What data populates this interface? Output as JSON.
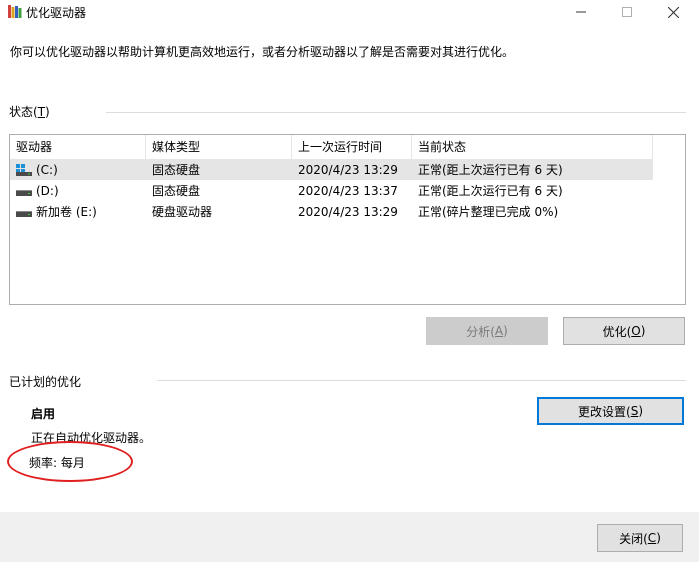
{
  "window": {
    "title": "优化驱动器",
    "minimize_icon": "minimize-icon",
    "maximize_icon": "maximize-icon",
    "close_icon": "close-icon"
  },
  "intro_text": "你可以优化驱动器以帮助计算机更高效地运行，或者分析驱动器以了解是否需要对其进行优化。",
  "status_section": {
    "label_main": "状态(",
    "label_key": "T",
    "label_end": ")"
  },
  "table": {
    "headers": [
      "驱动器",
      "媒体类型",
      "上一次运行时间",
      "当前状态"
    ],
    "rows": [
      {
        "drive": "(C:)",
        "icon": "system-drive-icon",
        "media": "固态硬盘",
        "last_run": "2020/4/23 13:29",
        "status": "正常(距上次运行已有 6 天)",
        "selected": true
      },
      {
        "drive": "(D:)",
        "icon": "drive-icon",
        "media": "固态硬盘",
        "last_run": "2020/4/23 13:37",
        "status": "正常(距上次运行已有 6 天)",
        "selected": false
      },
      {
        "drive": "新加卷 (E:)",
        "icon": "drive-icon",
        "media": "硬盘驱动器",
        "last_run": "2020/4/23 13:29",
        "status": "正常(碎片整理已完成 0%)",
        "selected": false
      }
    ]
  },
  "buttons": {
    "analyze": {
      "text": "分析(",
      "key": "A",
      "end": ")"
    },
    "optimize": {
      "text": "优化(",
      "key": "O",
      "end": ")"
    },
    "change_settings": {
      "text": "更改设置(",
      "key": "S",
      "end": ")"
    },
    "close": {
      "text": "关闭(",
      "key": "C",
      "end": ")"
    }
  },
  "schedule": {
    "section_label": "已计划的优化",
    "state": "启用",
    "description": "正在自动优化驱动器。",
    "frequency": "频率: 每月"
  },
  "colors": {
    "accent": "#0078d7",
    "annotation": "#e02020",
    "selected_row": "#e5e5e5",
    "bottom_bar": "#f0f0f0"
  }
}
